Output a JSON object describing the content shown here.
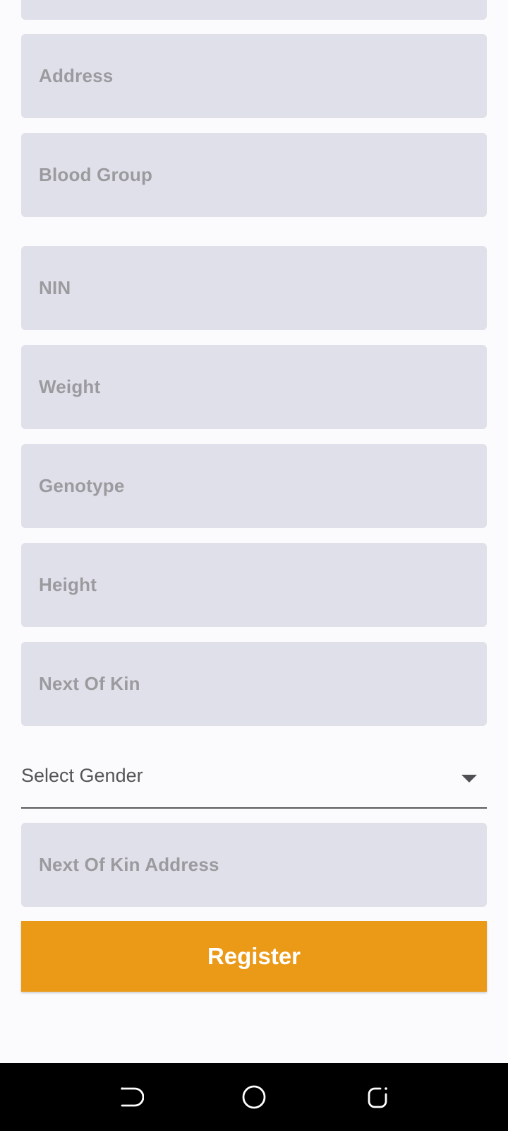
{
  "form": {
    "fields": [
      {
        "placeholder": "Address"
      },
      {
        "placeholder": "Blood Group"
      },
      {
        "placeholder": "NIN"
      },
      {
        "placeholder": "Weight"
      },
      {
        "placeholder": "Genotype"
      },
      {
        "placeholder": "Height"
      },
      {
        "placeholder": "Next Of Kin"
      },
      {
        "placeholder": "Next Of Kin Address"
      }
    ],
    "gender_select": {
      "label": "Select Gender"
    },
    "register_label": "Register"
  },
  "navbar": {
    "icons": [
      "back-icon",
      "home-icon",
      "recent-apps-icon"
    ]
  },
  "colors": {
    "background": "#fbfbfd",
    "field_bg": "#dfe0e9",
    "placeholder": "#9b9b9f",
    "accent": "#eb9a18"
  }
}
